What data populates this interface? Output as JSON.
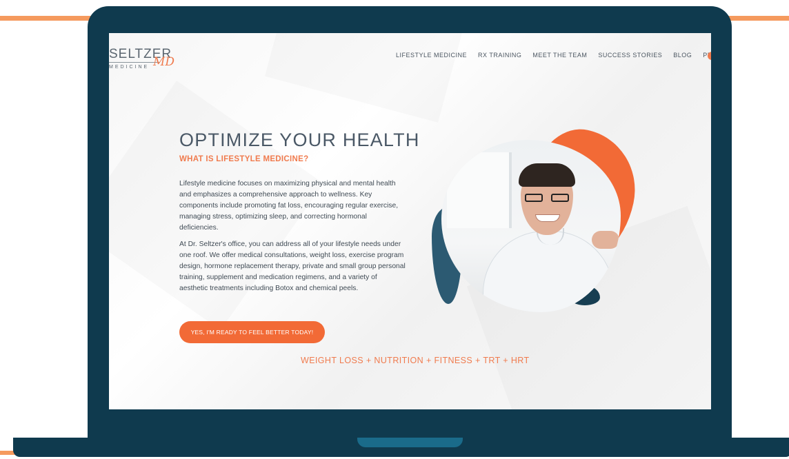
{
  "colors": {
    "frame": "#0f3a4e",
    "accent": "#f26a36",
    "accent_line": "#f59a5e",
    "heading": "#4a5866"
  },
  "logo": {
    "main": "SELTZER",
    "sub": "MEDICINE",
    "md": "MD"
  },
  "nav": {
    "items": [
      "LIFESTYLE MEDICINE",
      "RX TRAINING",
      "MEET THE TEAM",
      "SUCCESS STORIES",
      "BLOG",
      "PRESS"
    ]
  },
  "hero": {
    "title": "OPTIMIZE YOUR HEALTH",
    "subtitle": "WHAT IS LIFESTYLE MEDICINE?",
    "paragraph1": "Lifestyle medicine focuses on maximizing physical and mental health and emphasizes a comprehensive approach to wellness. Key components include promoting fat loss, encouraging regular exercise, managing stress, optimizing sleep, and correcting hormonal deficiencies.",
    "paragraph2": "At Dr. Seltzer's office, you can address all of your lifestyle needs under one roof. We offer medical consultations, weight loss, exercise program design, hormone replacement therapy, private and small group personal training, supplement and medication regimens, and a variety of aesthetic treatments including Botox and chemical peels.",
    "cta": "YES, I'M READY TO FEEL BETTER TODAY!",
    "tagline": "WEIGHT LOSS + NUTRITION + FITNESS + TRT + HRT"
  }
}
